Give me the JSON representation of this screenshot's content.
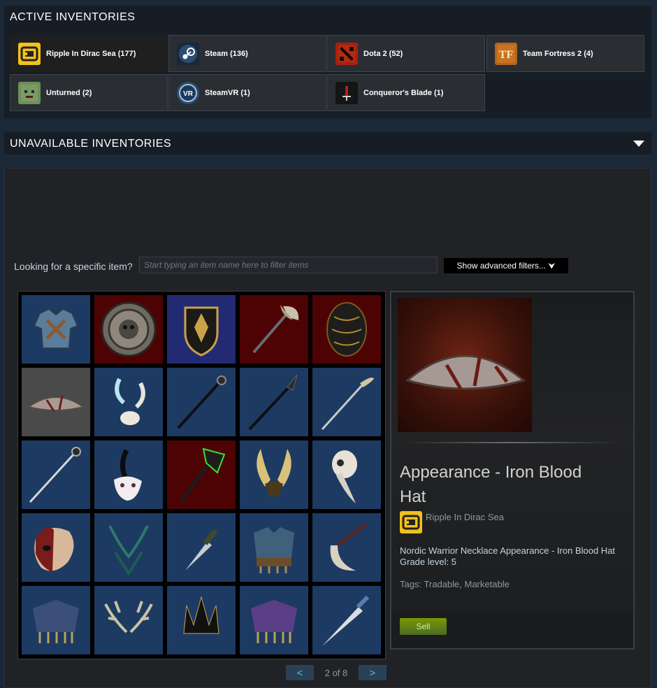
{
  "active_title": "ACTIVE INVENTORIES",
  "unavailable_title": "UNAVAILABLE INVENTORIES",
  "games": [
    {
      "label": "Ripple In Dirac Sea (177)",
      "icon": "ripple-dirac-sea-icon"
    },
    {
      "label": "Steam (136)",
      "icon": "steam-icon"
    },
    {
      "label": "Dota 2 (52)",
      "icon": "dota2-icon"
    },
    {
      "label": "Team Fortress 2 (4)",
      "icon": "tf2-icon"
    },
    {
      "label": "Unturned (2)",
      "icon": "unturned-icon"
    },
    {
      "label": "SteamVR (1)",
      "icon": "steamvr-icon"
    },
    {
      "label": "Conqueror's Blade (1)",
      "icon": "conquerors-blade-icon"
    }
  ],
  "filter": {
    "label": "Looking for a specific item?",
    "placeholder": "Start typing an item name here to filter items",
    "advanced_button": "Show advanced filters... ⮟"
  },
  "items": [
    {
      "name": "armor-vest",
      "bg": "blue"
    },
    {
      "name": "round-shield",
      "bg": "red"
    },
    {
      "name": "kite-shield",
      "bg": "purple"
    },
    {
      "name": "battle-axe",
      "bg": "red"
    },
    {
      "name": "dark-shield",
      "bg": "red"
    },
    {
      "name": "conical-hat",
      "bg": "gray"
    },
    {
      "name": "horn-ornament",
      "bg": "blue"
    },
    {
      "name": "staff",
      "bg": "blue"
    },
    {
      "name": "spear",
      "bg": "blue"
    },
    {
      "name": "winged-staff",
      "bg": "blue"
    },
    {
      "name": "wand",
      "bg": "blue"
    },
    {
      "name": "feather-mask",
      "bg": "blue"
    },
    {
      "name": "green-axe",
      "bg": "red"
    },
    {
      "name": "winged-helm",
      "bg": "blue"
    },
    {
      "name": "plague-mask",
      "bg": "blue"
    },
    {
      "name": "half-mask",
      "bg": "blue"
    },
    {
      "name": "antler-necklace",
      "bg": "blue"
    },
    {
      "name": "dagger",
      "bg": "blue"
    },
    {
      "name": "fur-vest",
      "bg": "blue"
    },
    {
      "name": "sickle",
      "bg": "blue"
    },
    {
      "name": "cape",
      "bg": "blue"
    },
    {
      "name": "antlers",
      "bg": "blue"
    },
    {
      "name": "spiked-crown",
      "bg": "blue"
    },
    {
      "name": "purple-cape",
      "bg": "blue"
    },
    {
      "name": "sword",
      "bg": "blue"
    }
  ],
  "detail": {
    "item_name": "Appearance - Iron Blood Hat",
    "game_name": "Ripple In Dirac Sea",
    "description": "Nordic Warrior Necklace Appearance - Iron Blood Hat Grade level: 5",
    "tags": "Tags: Tradable, Marketable",
    "sell_label": "Sell"
  },
  "pager": {
    "prev": "<",
    "next": ">",
    "text": "2 of 8"
  },
  "colors": {
    "blue": "#1d3a62",
    "red": "#4d0303",
    "purple": "#232a74",
    "gray": "#4a4a4a",
    "sell": "#5c7e10"
  }
}
